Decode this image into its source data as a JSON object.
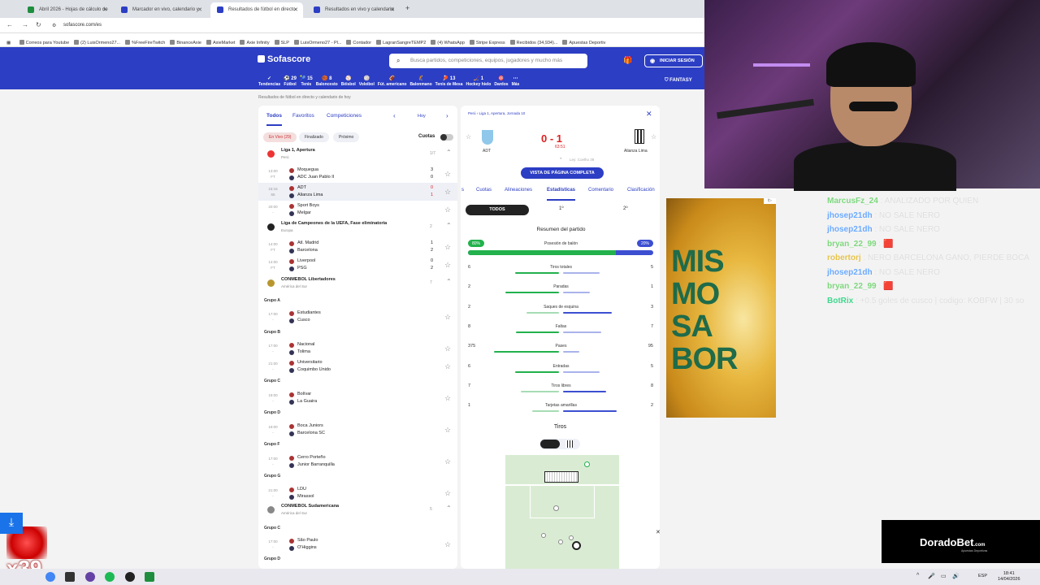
{
  "browser": {
    "tabs": [
      {
        "label": "Abril 2026 - Hojas de cálculo de",
        "color": "#1e8e3e"
      },
      {
        "label": "Marcador en vivo, calendario y",
        "color": "#2c3ec4"
      },
      {
        "label": "Resultados de fútbol en directo",
        "color": "#2c3ec4"
      },
      {
        "label": "Resultados en vivo y calendario",
        "color": "#2c3ec4"
      }
    ],
    "url": "sofascore.com/es",
    "bookmarks": [
      "Correos para Youtube",
      "(2) LuisOrmeno27...",
      "%FreeFireTwitch",
      "BinanceAxie",
      "AxieMarket",
      "Axie Infinity",
      "SLP",
      "LuisOrmeno27 - Pl...",
      "Contador",
      "LagranSangreTEMP2",
      "(4) WhatsApp",
      "Stripe Express",
      "Recibidos (34,934)...",
      "Apuestas Deportiv"
    ]
  },
  "header": {
    "logo": "Sofascore",
    "search_placeholder": "Busca partidos, competiciones, equipos, jugadores y mucho más",
    "login": "INICIAR SESIÓN",
    "fantasy": "FANTASY",
    "sports": [
      {
        "label": "Tendencias",
        "icon": "✓"
      },
      {
        "label": "Fútbol",
        "icon": "⚽ 29"
      },
      {
        "label": "Tenis",
        "icon": "🎾 15"
      },
      {
        "label": "Baloncesto",
        "icon": "🏀 8"
      },
      {
        "label": "Béisbol",
        "icon": "⚾"
      },
      {
        "label": "Voleibol",
        "icon": "🏐"
      },
      {
        "label": "Fút. americano",
        "icon": "🏈"
      },
      {
        "label": "Balonmano",
        "icon": "🤾"
      },
      {
        "label": "Tenis de Mesa",
        "icon": "🏓 13"
      },
      {
        "label": "Hockey hielo",
        "icon": "🏒 1"
      },
      {
        "label": "Dardos",
        "icon": "🎯"
      },
      {
        "label": "Más",
        "icon": "⋯"
      }
    ]
  },
  "breadcrumb": "Resultados de fútbol en directo y calendario de hoy",
  "left": {
    "tabs": [
      "Todos",
      "Favoritos",
      "Competiciones"
    ],
    "day": "Hoy",
    "chips": [
      "En Vivo (29)",
      "Finalizado",
      "Próximo"
    ],
    "cuotas": "Cuotas",
    "leagues": [
      {
        "name": "Liga 1, Apertura",
        "sub": "Perú",
        "count": "1/7"
      },
      {
        "name": "Liga de Campeones de la UEFA, Fase eliminatoria",
        "sub": "Europa",
        "count": "2"
      },
      {
        "name": "CONMEBOL Libertadores",
        "sub": "América del Sur",
        "count": "7"
      },
      {
        "name": "CONMEBOL Sudamericana",
        "sub": "América del Sur",
        "count": "5"
      }
    ],
    "matches": [
      {
        "time": "13:00",
        "status": "FT",
        "home": "Moquegua",
        "away": "ADC Juan Pablo II",
        "hs": "3",
        "as": "0"
      },
      {
        "time": "15:15",
        "status": "65",
        "home": "ADT",
        "away": "Alianza Lima",
        "hs": "0",
        "as": "1"
      },
      {
        "time": "20:00",
        "status": "-",
        "home": "Sport Boys",
        "away": "Melgar",
        "hs": "",
        "as": ""
      },
      {
        "time": "14:00",
        "status": "FT",
        "home": "Atl. Madrid",
        "away": "Barcelona",
        "hs": "1",
        "as": "2"
      },
      {
        "time": "14:00",
        "status": "FT",
        "home": "Liverpool",
        "away": "PSG",
        "hs": "0",
        "as": "2"
      },
      {
        "time": "17:00",
        "status": "-",
        "home": "Estudiantes",
        "away": "Cusco",
        "hs": "",
        "as": ""
      },
      {
        "time": "17:00",
        "status": "-",
        "home": "Nacional",
        "away": "Tolima",
        "hs": "",
        "as": ""
      },
      {
        "time": "21:00",
        "status": "-",
        "home": "Universitario",
        "away": "Coquimbo Unido",
        "hs": "",
        "as": ""
      },
      {
        "time": "19:00",
        "status": "-",
        "home": "Bolívar",
        "away": "La Guaira",
        "hs": "",
        "as": ""
      },
      {
        "time": "19:00",
        "status": "-",
        "home": "Boca Juniors",
        "away": "Barcelona SC",
        "hs": "",
        "as": ""
      },
      {
        "time": "17:00",
        "status": "-",
        "home": "Cerro Porteño",
        "away": "Junior Barranquilla",
        "hs": "",
        "as": ""
      },
      {
        "time": "21:00",
        "status": "-",
        "home": "LDU",
        "away": "Mirassol",
        "hs": "",
        "as": ""
      },
      {
        "time": "17:00",
        "status": "-",
        "home": "São Paulo",
        "away": "O'Higgins",
        "hs": "",
        "as": ""
      }
    ],
    "groups": [
      "Grupo A",
      "Grupo B",
      "Grupo C",
      "Grupo D",
      "Grupo F",
      "Grupo G",
      "Grupo C",
      "Grupo D"
    ]
  },
  "match": {
    "title": "Perú › Liga 1, Apertura, Jornada 10",
    "score": "0 - 1",
    "clock": "63:51",
    "home": "ADT",
    "away": "Alianza Lima",
    "referee": "Ley: Coelho 39",
    "full_button": "VISTA DE PÁGINA COMPLETA",
    "tabs": [
      "s",
      "Cuotas",
      "Alineaciones",
      "Estadísticas",
      "Comentario",
      "Clasificación"
    ],
    "periods": [
      "TODOS",
      "1º",
      "2º"
    ],
    "summary_title": "Resumen del partido",
    "possession_label": "Posesión de balón",
    "possession_home": "80%",
    "possession_away": "20%",
    "possession_home_value": 0.8,
    "stats": [
      {
        "label": "Tiros totales",
        "h": "6",
        "a": "5",
        "hf": 0.54,
        "af": 0.45
      },
      {
        "label": "Paradas",
        "h": "2",
        "a": "1",
        "hf": 0.66,
        "af": 0.33
      },
      {
        "label": "Saques de esquina",
        "h": "2",
        "a": "3",
        "hf": 0.4,
        "af": 0.6
      },
      {
        "label": "Faltas",
        "h": "8",
        "a": "7",
        "hf": 0.53,
        "af": 0.47
      },
      {
        "label": "Pases",
        "h": "375",
        "a": "95",
        "hf": 0.8,
        "af": 0.2
      },
      {
        "label": "Entradas",
        "h": "6",
        "a": "5",
        "hf": 0.54,
        "af": 0.45
      },
      {
        "label": "Tiros libres",
        "h": "7",
        "a": "8",
        "hf": 0.47,
        "af": 0.53
      },
      {
        "label": "Tarjetas amarillas",
        "h": "1",
        "a": "2",
        "hf": 0.33,
        "af": 0.66
      }
    ],
    "shots_title": "Tiros"
  },
  "ad": {
    "text": "MIS MO SA BOR"
  },
  "chat": [
    {
      "user": "MarcusFz_24",
      "color": "#7cd67c",
      "text": "ANALIZADO POR QUIEN"
    },
    {
      "user": "jhosep21dh",
      "color": "#6aa9ff",
      "text": "NO SALE NERO"
    },
    {
      "user": "jhosep21dh",
      "color": "#6aa9ff",
      "text": "NO SALE NERO"
    },
    {
      "user": "bryan_22_99",
      "color": "#7cd67c",
      "text": "🟥"
    },
    {
      "user": "robertorj",
      "color": "#e6c34a",
      "text": "NERO BARCELONA GANO, PIERDE BOCA"
    },
    {
      "user": "jhosep21dh",
      "color": "#6aa9ff",
      "text": "NO SALE NERO"
    },
    {
      "user": "bryan_22_99",
      "color": "#7cd67c",
      "text": "🟥"
    },
    {
      "user": "BotRix",
      "color": "#3dd68c",
      "text": "+0.5 goles de cusco | codigo: KOBFW | 30 so"
    }
  ],
  "sponsor": {
    "name": "DoradoBet",
    "suffix": ".com",
    "sub": "Apuestas Deportivas"
  },
  "overlay": {
    "counter": "x39"
  },
  "taskbar": {
    "lang": "ESP",
    "time": "18:41",
    "date": "14/04/2026"
  }
}
